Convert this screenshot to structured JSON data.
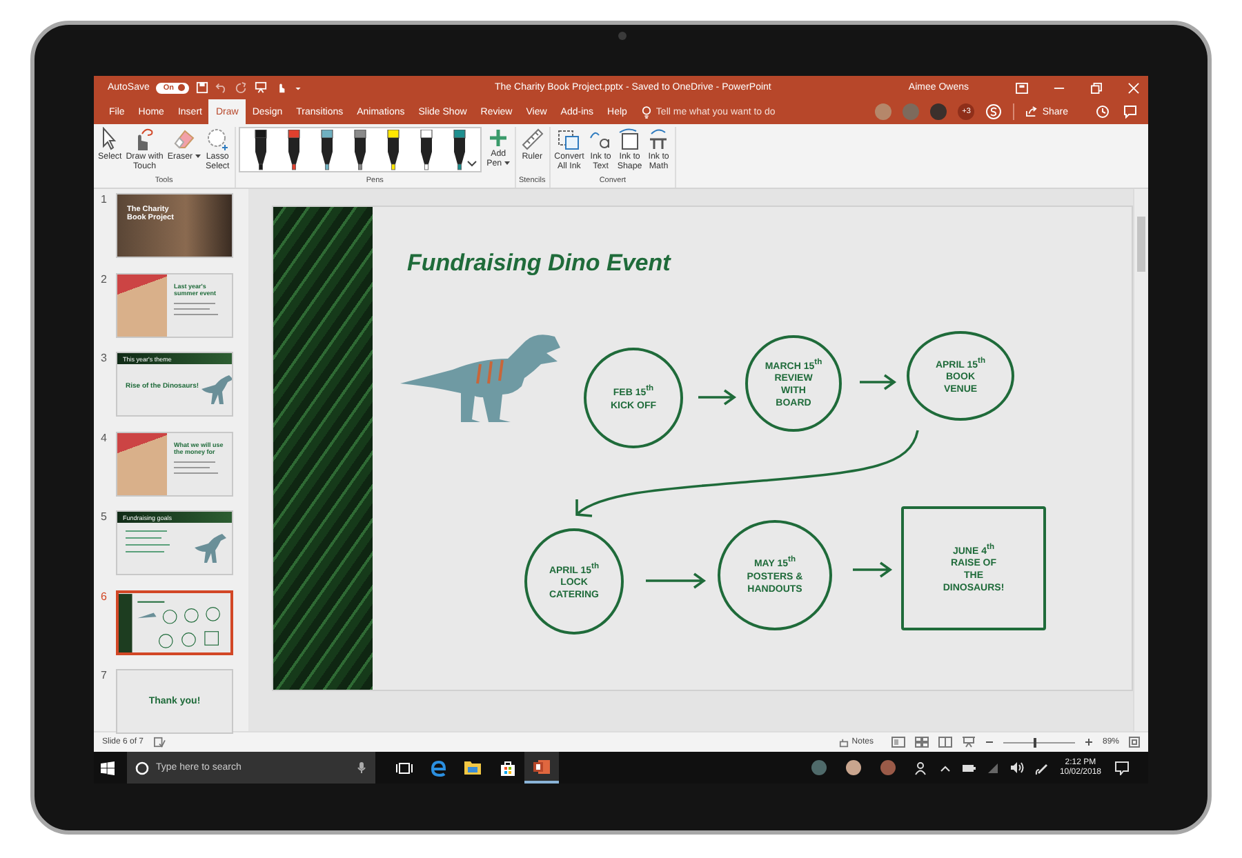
{
  "title_bar": {
    "autosave_label": "AutoSave",
    "autosave_on": true,
    "autosave_state": "On",
    "document_title": "The Charity Book Project.pptx - Saved to OneDrive - PowerPoint",
    "user_name": "Aimee Owens"
  },
  "tabs": [
    {
      "label": "File",
      "selected": false
    },
    {
      "label": "Home",
      "selected": false
    },
    {
      "label": "Insert",
      "selected": false
    },
    {
      "label": "Draw",
      "selected": true
    },
    {
      "label": "Design",
      "selected": false
    },
    {
      "label": "Transitions",
      "selected": false
    },
    {
      "label": "Animations",
      "selected": false
    },
    {
      "label": "Slide Show",
      "selected": false
    },
    {
      "label": "Review",
      "selected": false
    },
    {
      "label": "View",
      "selected": false
    },
    {
      "label": "Add-ins",
      "selected": false
    },
    {
      "label": "Help",
      "selected": false
    }
  ],
  "tell_me": {
    "placeholder": "Tell me what you want to do"
  },
  "collaborators": {
    "more": "+3"
  },
  "share_button": "Share",
  "ribbon": {
    "groups": [
      {
        "label": "Tools",
        "kind": "items",
        "items": [
          {
            "kind": "select",
            "lines": [
              "Select"
            ]
          },
          {
            "kind": "touch",
            "lines": [
              "Draw with",
              "Touch"
            ]
          },
          {
            "kind": "eraser",
            "lines": [
              "Eraser"
            ],
            "dropdown": true
          },
          {
            "kind": "lasso",
            "lines": [
              "Lasso",
              "Select"
            ]
          }
        ]
      },
      {
        "label": "Pens",
        "kind": "pens",
        "pens": [
          {
            "color": "#1a1a1a"
          },
          {
            "color": "#e0402e"
          },
          {
            "color": "#6fb0c0"
          },
          {
            "color": "#8a8a8a"
          },
          {
            "color": "#ffe600"
          },
          {
            "color": "#ffffff"
          },
          {
            "color": "#1f8f8f"
          }
        ],
        "items": [
          {
            "kind": "add-pen",
            "lines": [
              "Add",
              "Pen"
            ],
            "dropdown": true
          }
        ]
      },
      {
        "label": "Stencils",
        "kind": "items",
        "items": [
          {
            "kind": "ruler",
            "lines": [
              "Ruler"
            ]
          }
        ]
      },
      {
        "label": "Convert",
        "kind": "items",
        "items": [
          {
            "kind": "convert",
            "lines": [
              "Convert",
              "All Ink"
            ]
          },
          {
            "kind": "ink-text",
            "lines": [
              "Ink to",
              "Text"
            ]
          },
          {
            "kind": "ink-shape",
            "lines": [
              "Ink to",
              "Shape"
            ]
          },
          {
            "kind": "ink-math",
            "lines": [
              "Ink to",
              "Math"
            ]
          }
        ]
      }
    ]
  },
  "thumbnails": [
    {
      "number": "1",
      "selected": false,
      "kind": "photo-title",
      "title": "The Charity Book Project"
    },
    {
      "number": "2",
      "selected": false,
      "kind": "photo-left",
      "title": "Last year's summer event"
    },
    {
      "number": "3",
      "selected": false,
      "kind": "banner-dino",
      "header": "This year's theme",
      "title": "Rise of the Dinosaurs!"
    },
    {
      "number": "4",
      "selected": false,
      "kind": "photo-left",
      "title": "What we will use the money for"
    },
    {
      "number": "5",
      "selected": false,
      "kind": "banner-dino",
      "header": "Fundraising goals"
    },
    {
      "number": "6",
      "selected": true,
      "kind": "ink"
    },
    {
      "number": "7",
      "selected": false,
      "kind": "closing",
      "title": "Thank you!"
    }
  ],
  "slide": {
    "title": "Fundraising Dino Event",
    "nodes": [
      {
        "kind": "circle",
        "lines": [
          "FEB 15$^{th}$",
          "KICK OFF"
        ]
      },
      {
        "kind": "circle",
        "lines": [
          "MARCH 15$^{th}$",
          "REVIEW",
          "WITH",
          "BOARD"
        ]
      },
      {
        "kind": "circle",
        "lines": [
          "APRIL 15$^{th}$",
          "BOOK",
          "VENUE"
        ]
      },
      {
        "kind": "circle",
        "lines": [
          "APRIL 15$^{th}$",
          "LOCK",
          "CATERING"
        ]
      },
      {
        "kind": "circle",
        "lines": [
          "MAY 15$^{th}$",
          "POSTERS &",
          "HANDOUTS"
        ]
      },
      {
        "kind": "rect",
        "lines": [
          "JUNE 4$^{th}$",
          "RAISE OF",
          "THE",
          "DINOSAURS!"
        ]
      }
    ]
  },
  "status_bar": {
    "slide_indicator": "Slide 6 of 7",
    "notes_label": "Notes",
    "zoom": {
      "level": 0.45,
      "reading": "89%"
    }
  },
  "taskbar": {
    "search": {
      "placeholder": "Type here to search"
    },
    "apps": [
      {
        "kind": "task-view",
        "active": false
      },
      {
        "kind": "browser",
        "active": false
      },
      {
        "kind": "folder",
        "active": false
      },
      {
        "kind": "store",
        "active": false
      },
      {
        "kind": "slides",
        "active": true
      }
    ],
    "time": "2:12 PM",
    "date": "10/02/2018"
  }
}
